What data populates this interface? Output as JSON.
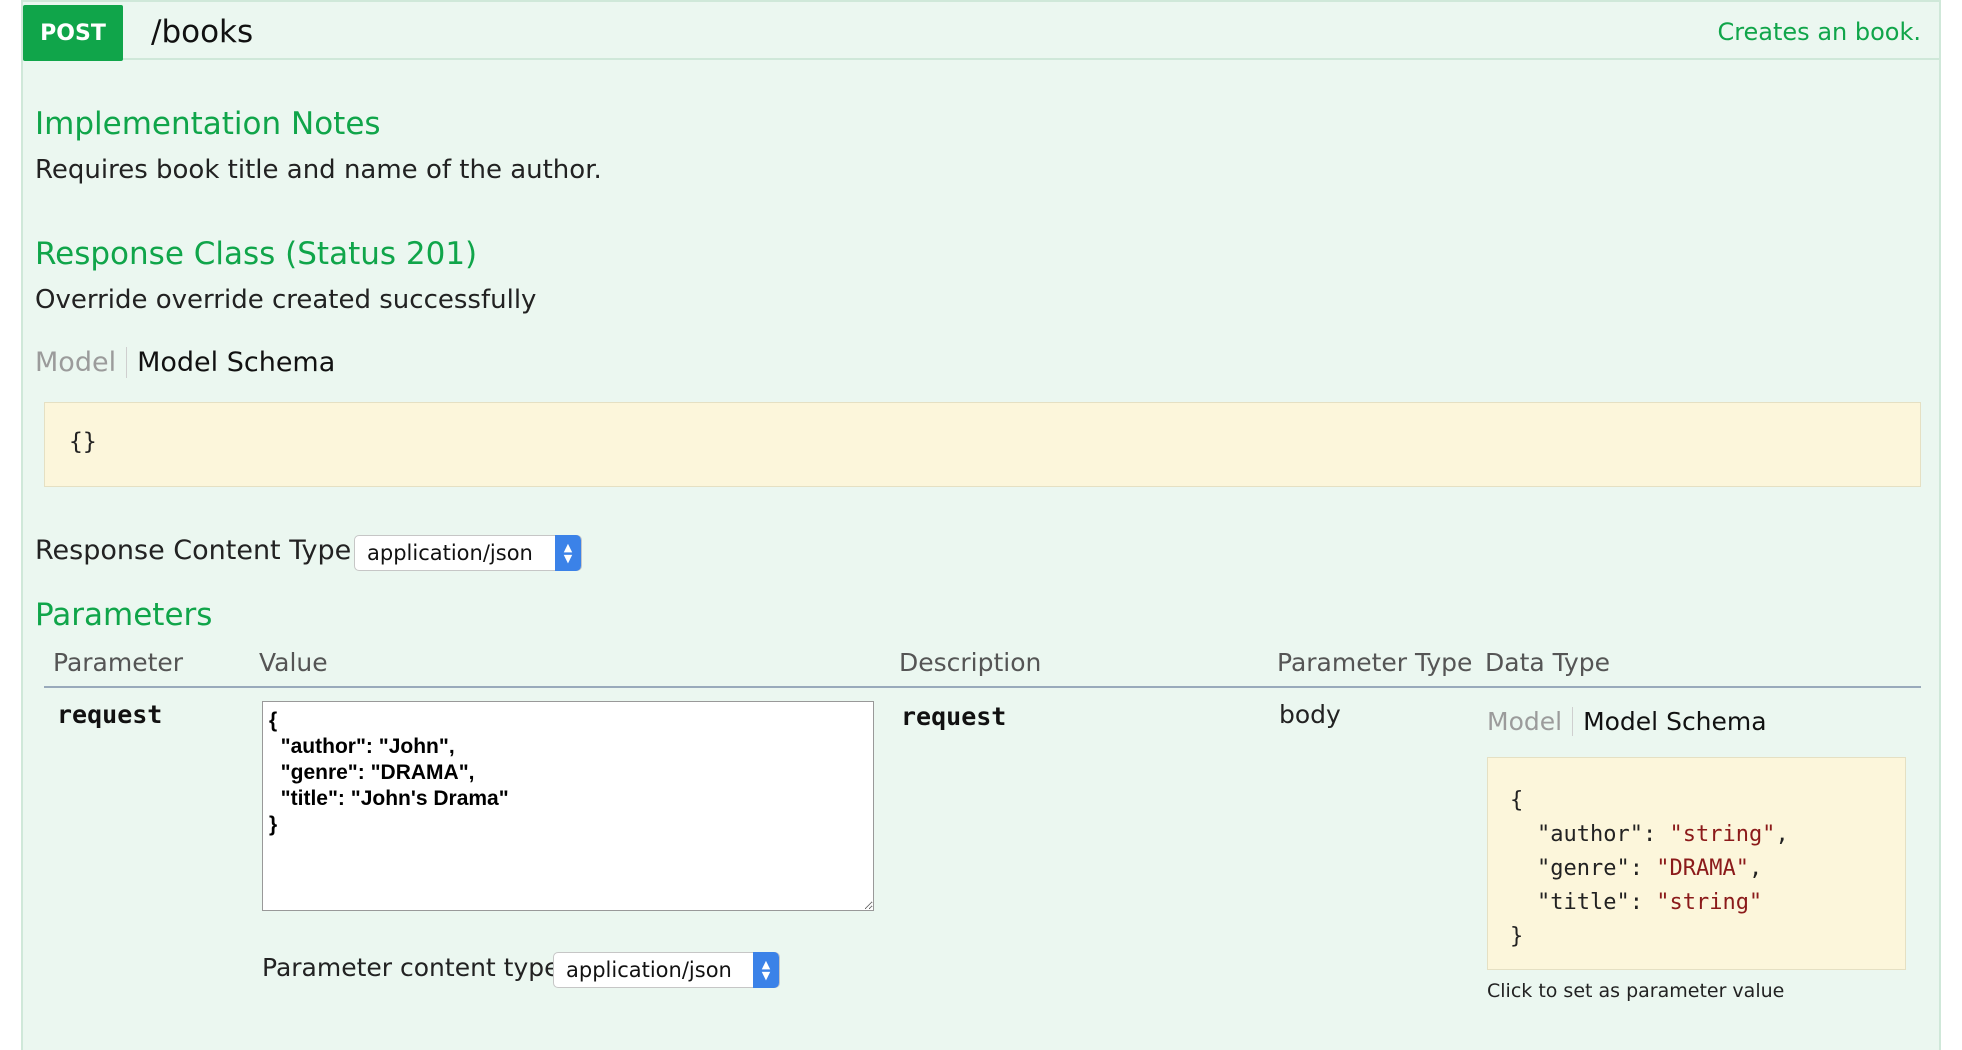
{
  "operation": {
    "method": "POST",
    "path": "/books",
    "summary": "Creates an book."
  },
  "implementation_notes": {
    "heading": "Implementation Notes",
    "text": "Requires book title and name of the author."
  },
  "response_class": {
    "heading": "Response Class (Status 201)",
    "text": "Override override created successfully",
    "tab_model": "Model",
    "tab_model_schema": "Model Schema",
    "schema": "{}"
  },
  "response_content_type": {
    "label": "Response Content Type",
    "selected": "application/json"
  },
  "parameters": {
    "heading": "Parameters",
    "columns": [
      "Parameter",
      "Value",
      "Description",
      "Parameter Type",
      "Data Type"
    ],
    "rows": [
      {
        "name": "request",
        "value": "{\n  \"author\": \"John\",\n  \"genre\": \"DRAMA\",\n  \"title\": \"John's Drama\"\n}",
        "description": "request",
        "param_type": "body",
        "data_type": {
          "tab_model": "Model",
          "tab_model_schema": "Model Schema",
          "schema": {
            "open": "{",
            "close": "}",
            "fields": [
              {
                "key": "\"author\"",
                "value": "\"string\"",
                "sep": ","
              },
              {
                "key": "\"genre\"",
                "value": "\"DRAMA\"",
                "sep": ","
              },
              {
                "key": "\"title\"",
                "value": "\"string\"",
                "sep": ""
              }
            ]
          },
          "hint": "Click to set as parameter value"
        },
        "content_type_label": "Parameter content type:",
        "content_type_selected": "application/json"
      }
    ]
  },
  "colors": {
    "post": "#10a54a",
    "heading": "#10a54a",
    "background": "#ebf7f0",
    "snippet_bg": "#fcf6db",
    "select_arrow": "#3b82e8"
  }
}
